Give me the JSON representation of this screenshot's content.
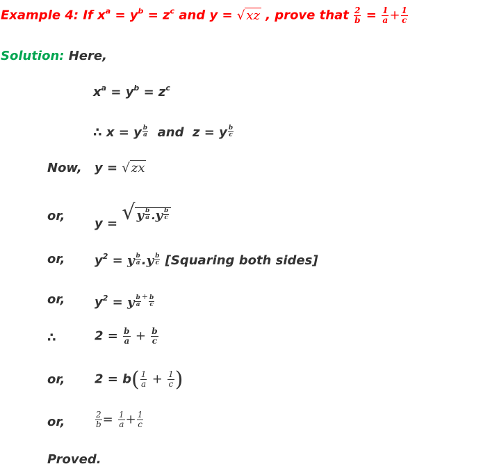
{
  "title": {
    "prefix": "Example 4: If ",
    "eq1_x": "x",
    "eq1_a": "a",
    "eq_sign": " = ",
    "eq1_y": "y",
    "eq1_b": "b",
    "eq1_z": "z",
    "eq1_c": "c",
    "and": " and ",
    "y": "y",
    "sqrt_arg": "xz",
    "prove": " , prove that ",
    "frac_lhs": {
      "num": "2",
      "den": "b"
    },
    "frac_a": {
      "num": "1",
      "den": "a"
    },
    "frac_c": {
      "num": "1",
      "den": "c"
    },
    "plus": "+",
    "color": "#ff0000"
  },
  "solution": {
    "label": "Solution:",
    "label_color": "#00a550",
    "here": " Here,"
  },
  "steps": {
    "given": {
      "x": "x",
      "a": "a",
      "y": "y",
      "b": "b",
      "z": "z",
      "c": "c",
      "eq": " = "
    },
    "therefore_line": {
      "symbol": "∴",
      "x": "x",
      "eq": " = ",
      "y": "y",
      "exp_num": "b",
      "exp_den_a": "a",
      "exp_den_c": "c",
      "and": "and",
      "z": "z"
    },
    "now_line": {
      "label": "Now,",
      "y": "y",
      "eq": " = ",
      "sqrt_arg": "zx"
    },
    "or_labels": [
      "or,",
      "or,",
      "or,",
      "or,",
      "or,"
    ],
    "line_sqrt": {
      "y": "y",
      "eq": " = ",
      "base": "y",
      "dot": "."
    },
    "line_square": {
      "y": "y",
      "pow": "2",
      "eq": " = ",
      "base": "y",
      "dot": ".",
      "note": " [Squaring both sides]"
    },
    "line_sum": {
      "y": "y",
      "pow": "2",
      "eq": " = ",
      "base": "y",
      "plus": "+"
    },
    "therefore2": {
      "symbol": "∴",
      "two": "2",
      "eq": " = ",
      "plus": "+",
      "b": "b",
      "a": "a",
      "c": "c"
    },
    "factored": {
      "two": "2",
      "eq": " = ",
      "b": "b",
      "one": "1",
      "a": "a",
      "c": "c",
      "plus": "+"
    },
    "final": {
      "two": "2",
      "b": "b",
      "eq": "=",
      "one": "1",
      "a": "a",
      "c": "c",
      "plus": "+"
    },
    "proved": "Proved."
  }
}
